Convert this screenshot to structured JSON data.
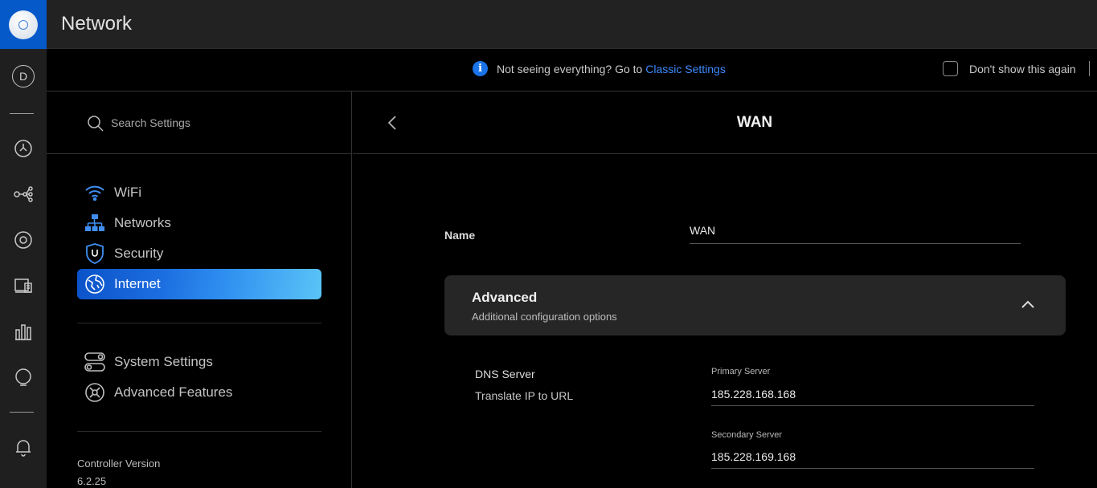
{
  "app": {
    "title": "Network"
  },
  "rail": {
    "avatar_letter": "D",
    "icons": [
      "dashboard-icon",
      "topology-icon",
      "devices-icon",
      "clients-icon",
      "statistics-icon",
      "insights-icon",
      "notifications-icon"
    ]
  },
  "notice": {
    "message": "Not seeing everything? Go to ",
    "link": "Classic Settings",
    "dont_show": "Don't show this again",
    "checked": false
  },
  "search": {
    "placeholder": "Search Settings"
  },
  "nav": {
    "items": [
      {
        "label": "WiFi",
        "icon": "wifi-icon"
      },
      {
        "label": "Networks",
        "icon": "networks-icon"
      },
      {
        "label": "Security",
        "icon": "shield-icon"
      },
      {
        "label": "Internet",
        "icon": "globe-icon",
        "active": true
      }
    ],
    "secondary": [
      {
        "label": "System Settings",
        "icon": "toggle-icon"
      },
      {
        "label": "Advanced Features",
        "icon": "tools-icon"
      }
    ],
    "controller_version_label": "Controller Version",
    "controller_version": "6.2.25"
  },
  "page": {
    "title": "WAN",
    "name_label": "Name",
    "name_value": "WAN",
    "advanced": {
      "title": "Advanced",
      "subtitle": "Additional configuration options"
    },
    "dns": {
      "label": "DNS Server",
      "sublabel": "Translate IP to URL",
      "primary_label": "Primary Server",
      "primary_value": "185.228.168.168",
      "secondary_label": "Secondary Server",
      "secondary_value": "185.228.169.168"
    }
  },
  "colors": {
    "accent": "#1a73e8",
    "link": "#3d8bfd",
    "brand": "#0559c9"
  }
}
